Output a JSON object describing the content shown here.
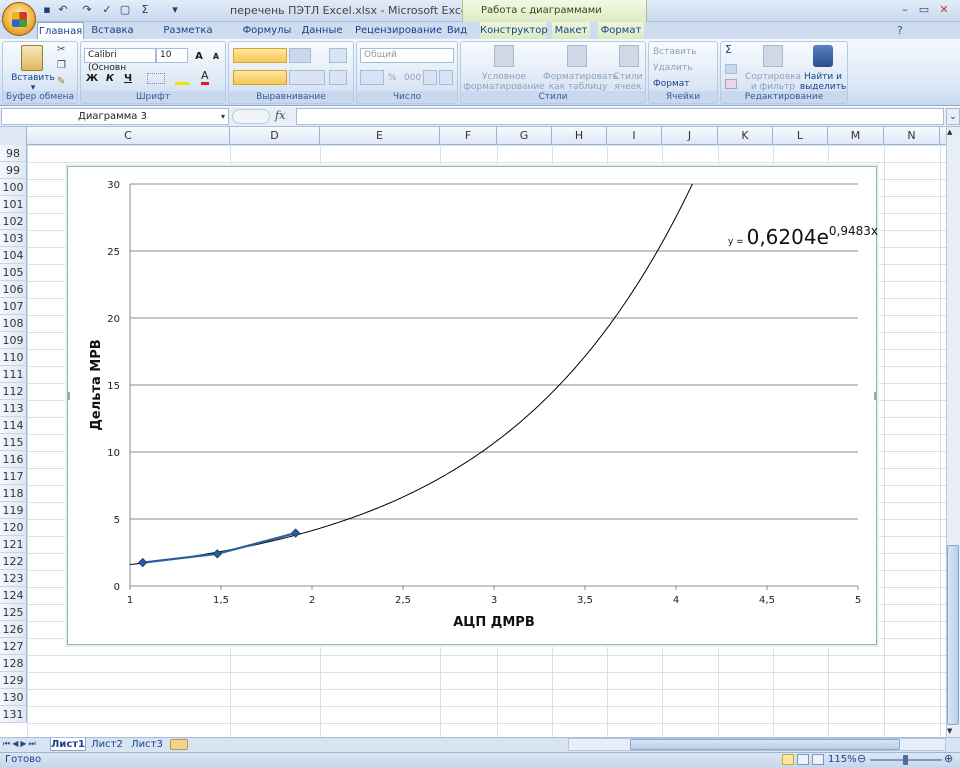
{
  "window": {
    "title": "перечень ПЭТЛ Excel.xlsx - Microsoft Excel",
    "context_tools": "Работа с диаграммами"
  },
  "tabs": [
    "Главная",
    "Вставка",
    "Разметка страницы",
    "Формулы",
    "Данные",
    "Рецензирование",
    "Вид",
    "Конструктор",
    "Макет",
    "Формат"
  ],
  "ribbon": {
    "clipboard": {
      "group": "Буфер обмена",
      "paste": "Вставить"
    },
    "font": {
      "group": "Шрифт",
      "font_name": "Calibri (Основн",
      "font_size": "10",
      "bold": "Ж",
      "italic": "К",
      "underline": "Ч"
    },
    "alignment": {
      "group": "Выравнивание"
    },
    "number": {
      "group": "Число",
      "format": "Общий",
      "percent": "%",
      "thousands": "000"
    },
    "styles": {
      "group": "Стили",
      "conditional": "Условное форматирование",
      "as_table": "Форматировать как таблицу",
      "cell_styles": "Стили ячеек"
    },
    "cells": {
      "group": "Ячейки",
      "insert": "Вставить",
      "delete": "Удалить",
      "format": "Формат"
    },
    "editing": {
      "group": "Редактирование",
      "sort": "Сортировка и фильтр",
      "find": "Найти и выделить",
      "sigma": "Σ"
    }
  },
  "formula_bar": {
    "name_box": "Диаграмма 3",
    "fx": "fx",
    "formula": ""
  },
  "columns": [
    "C",
    "D",
    "E",
    "F",
    "G",
    "H",
    "I",
    "J",
    "K",
    "L",
    "M",
    "N"
  ],
  "rows": [
    "98",
    "99",
    "100",
    "101",
    "102",
    "103",
    "104",
    "105",
    "106",
    "107",
    "108",
    "109",
    "110",
    "111",
    "112",
    "113",
    "114",
    "115",
    "116",
    "117",
    "118",
    "119",
    "120",
    "121",
    "122",
    "123",
    "124",
    "125",
    "126",
    "127",
    "128",
    "129",
    "130",
    "131"
  ],
  "sheets": [
    "Лист1",
    "Лист2",
    "Лист3"
  ],
  "status": {
    "text": "Готово",
    "zoom": "115%"
  },
  "chart_data": {
    "type": "scatter",
    "xlabel": "АЦП ДМРВ",
    "ylabel": "Дельта МРВ",
    "xlim": [
      1,
      5
    ],
    "ylim": [
      0,
      30
    ],
    "x_ticks": [
      "1",
      "1,5",
      "2",
      "2,5",
      "3",
      "3,5",
      "4",
      "4,5",
      "5"
    ],
    "y_ticks": [
      "0",
      "5",
      "10",
      "15",
      "20",
      "25",
      "30"
    ],
    "series": [
      {
        "x": [
          1.07,
          1.48,
          1.91
        ],
        "y": [
          1.75,
          2.4,
          3.95
        ],
        "color": "#2a5e9e"
      }
    ],
    "trendline": {
      "type": "exponential",
      "a": 0.6204,
      "b": 0.9483,
      "color": "#000000",
      "prefix": "y = ",
      "coef": "0,6204e",
      "exponent": "0,9483x"
    },
    "grid": true
  }
}
